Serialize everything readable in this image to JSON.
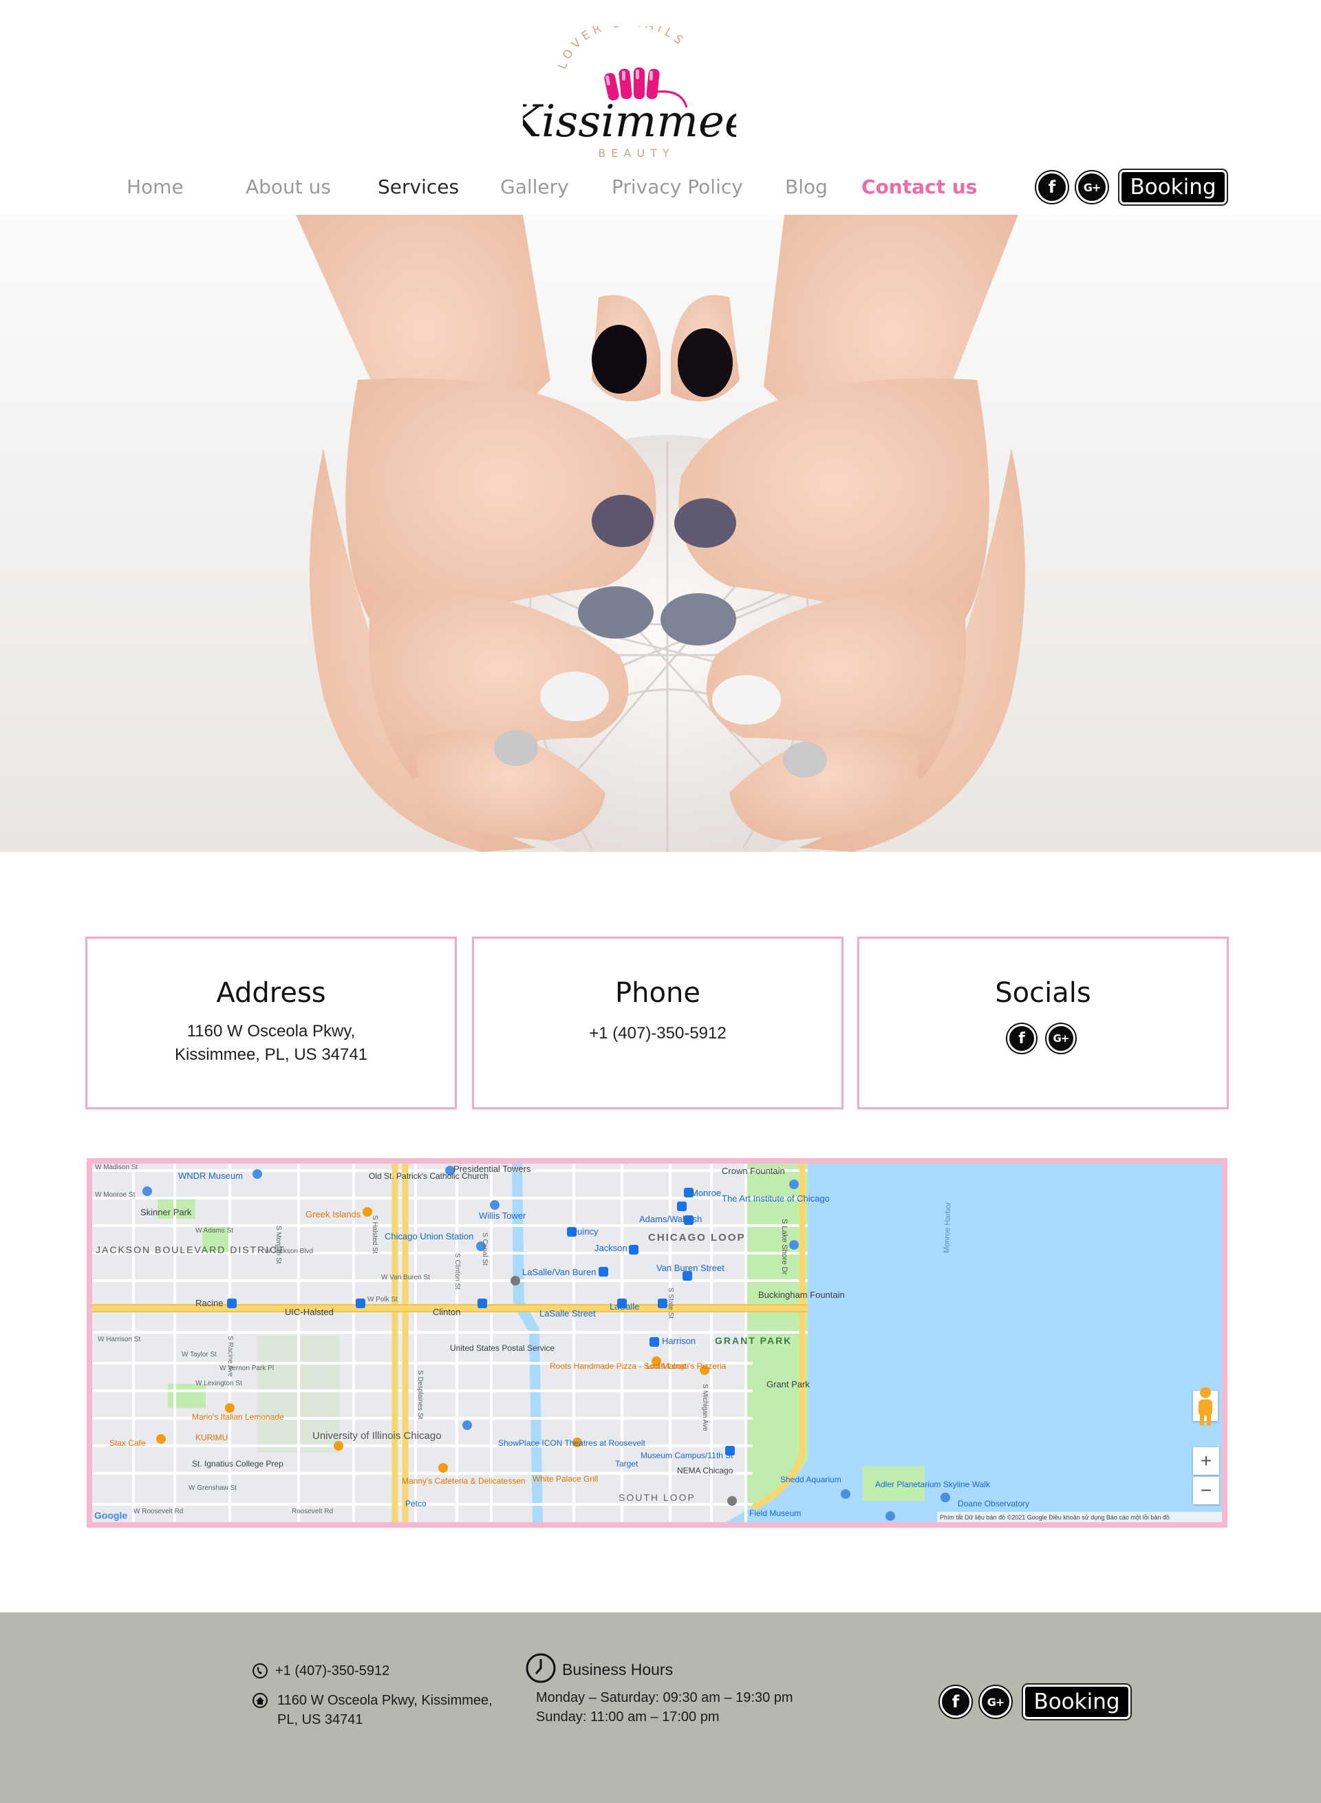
{
  "brand": {
    "arc_text": "LOVER'S NAILS",
    "name": "Kissimmee",
    "sub": "BEAUTY"
  },
  "nav": {
    "items": [
      {
        "label": "Home"
      },
      {
        "label": "About us"
      },
      {
        "label": "Services"
      },
      {
        "label": "Gallery"
      },
      {
        "label": "Privacy Policy"
      },
      {
        "label": "Blog"
      },
      {
        "label": "Contact us"
      }
    ],
    "active": "Services",
    "highlight": "Contact us",
    "booking_label": "Booking"
  },
  "socials": {
    "facebook": "f",
    "google_plus": "G+"
  },
  "cards": {
    "address": {
      "title": "Address",
      "line1": "1160 W Osceola Pkwy,",
      "line2": "Kissimmee, PL, US 34741"
    },
    "phone": {
      "title": "Phone",
      "value": "+1 (407)-350-5912"
    },
    "socials": {
      "title": "Socials"
    }
  },
  "map": {
    "labels": {
      "wndr": "WNDR Museum",
      "presidential": "Presidential Towers",
      "oldst": "Old St. Patrick's Catholic Church",
      "skinner": "Skinner Park",
      "greek": "Greek Islands",
      "willis": "Willis Tower",
      "union": "Chicago Union Station",
      "quincy": "Quincy",
      "jackson_station": "Jackson",
      "loop": "CHICAGO LOOP",
      "art": "The Art Institute of Chicago",
      "crown": "Crown Fountain",
      "monroe": "Monroe",
      "adams": "Adams/Wabash",
      "lasalle_van": "LaSalle/Van Buren",
      "van_buren": "Van Buren Street",
      "buckingham": "Buckingham Fountain",
      "racine": "Racine",
      "uic": "UIC-Halsted",
      "clinton": "Clinton",
      "lasalle": "LaSalle",
      "lasalle_street": "LaSalle Street",
      "grant_park": "GRANT PARK",
      "harrison": "Harrison",
      "postal": "United States Postal Service",
      "roots": "Roots Handmade Pizza - South Loop",
      "lou": "Lou Malnati's Pizzeria",
      "grant_park2": "Grant Park",
      "jackson_blvd": "JACKSON BOULEVARD DISTRICT",
      "uofi": "University of Illinois Chicago",
      "marios": "Mario's Italian Lemonade",
      "kurimu": "KURIMU",
      "stax": "Stax Cafe",
      "ignatius": "St. Ignatius College Prep",
      "showplace": "ShowPlace ICON Theatres at Roosevelt",
      "target": "Target",
      "museum_campus": "Museum Campus/11th St",
      "nema": "NEMA Chicago",
      "south_loop": "SOUTH LOOP",
      "white_palace": "White Palace Grill",
      "mannys": "Manny's Cafeteria & Delicatessen",
      "petco": "Petco",
      "shedd": "Shedd Aquarium",
      "adler": "Adler Planetarium Skyline Walk",
      "doane": "Doane Observatory",
      "field": "Field Museum",
      "lake_shore": "S Lake Shore Dr",
      "monroe_harbor": "Monroe Harbor",
      "google": "Google",
      "madison": "W Madison St",
      "monroe_st": "W Monroe St",
      "adams_st": "W Adams St",
      "jackson_st": "W Jackson Blvd",
      "harrison_st": "W Harrison St",
      "roosevelt": "Roosevelt Rd",
      "roosevelt_w": "W Roosevelt Rd",
      "van_buren_st": "W Van Buren St",
      "halsted": "S Halsted St",
      "canal": "S Canal St",
      "michigan": "S Michigan Ave",
      "state": "S State St",
      "racine_ave": "S Racine Ave",
      "desplaines": "S Desplaines St",
      "clinton_st": "S Clinton St",
      "morgan": "S Morgan St",
      "taylor": "W Taylor St",
      "polk": "W Polk St",
      "vernon": "W Vernon Park Pl",
      "lexington": "W Lexington St",
      "grenshaw": "W Grenshaw St",
      "ordinance": "Phím tắt   Dữ liệu bản đồ ©2021 Google   Điều khoản sử dụng   Báo cáo một lỗi bản đồ"
    },
    "zoom_in": "+",
    "zoom_out": "−"
  },
  "footer": {
    "phone": "+1 (407)-350-5912",
    "address_line1": "1160 W Osceola Pkwy, Kissimmee,",
    "address_line2": "PL, US 34741",
    "hours_title": "Business Hours",
    "hours_weekday": "Monday – Saturday: 09:30 am – 19:30 pm",
    "hours_sunday": "Sunday: 11:00 am – 17:00 pm",
    "booking_label": "Booking"
  },
  "colors": {
    "accent_pink": "#ef6aa8",
    "card_border": "#f2a9c7",
    "map_border": "#f6b8cf",
    "footer_bg": "#b7b7ae",
    "button_bg": "#000000"
  }
}
